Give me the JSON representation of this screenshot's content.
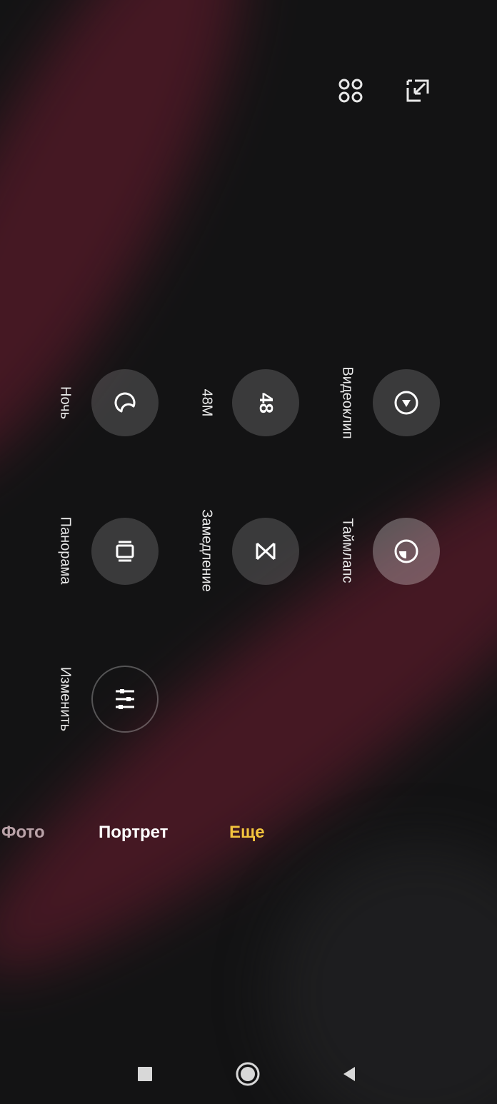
{
  "top_bar": {
    "grid_icon": "grid-icon",
    "crop_icon": "crop-icon"
  },
  "modes": [
    {
      "label": "Ночь",
      "icon": "moon-icon"
    },
    {
      "label": "48M",
      "icon": "48",
      "icon_text": "48"
    },
    {
      "label": "Видеоклип",
      "icon": "play-circle-icon"
    },
    {
      "label": "Панорама",
      "icon": "panorama-icon"
    },
    {
      "label": "Замедление",
      "icon": "slow-motion-icon"
    },
    {
      "label": "Таймлапс",
      "icon": "timelapse-icon"
    },
    {
      "label": "Изменить",
      "icon": "sliders-icon"
    }
  ],
  "tabs": [
    {
      "label": "Фото",
      "color": "#b9a2a8"
    },
    {
      "label": "Портрет",
      "color": "#ffffff"
    },
    {
      "label": "Еще",
      "color": "#f3c43d"
    }
  ],
  "navbar": {
    "recents": "square-icon",
    "home": "circle-icon",
    "back": "triangle-icon"
  }
}
